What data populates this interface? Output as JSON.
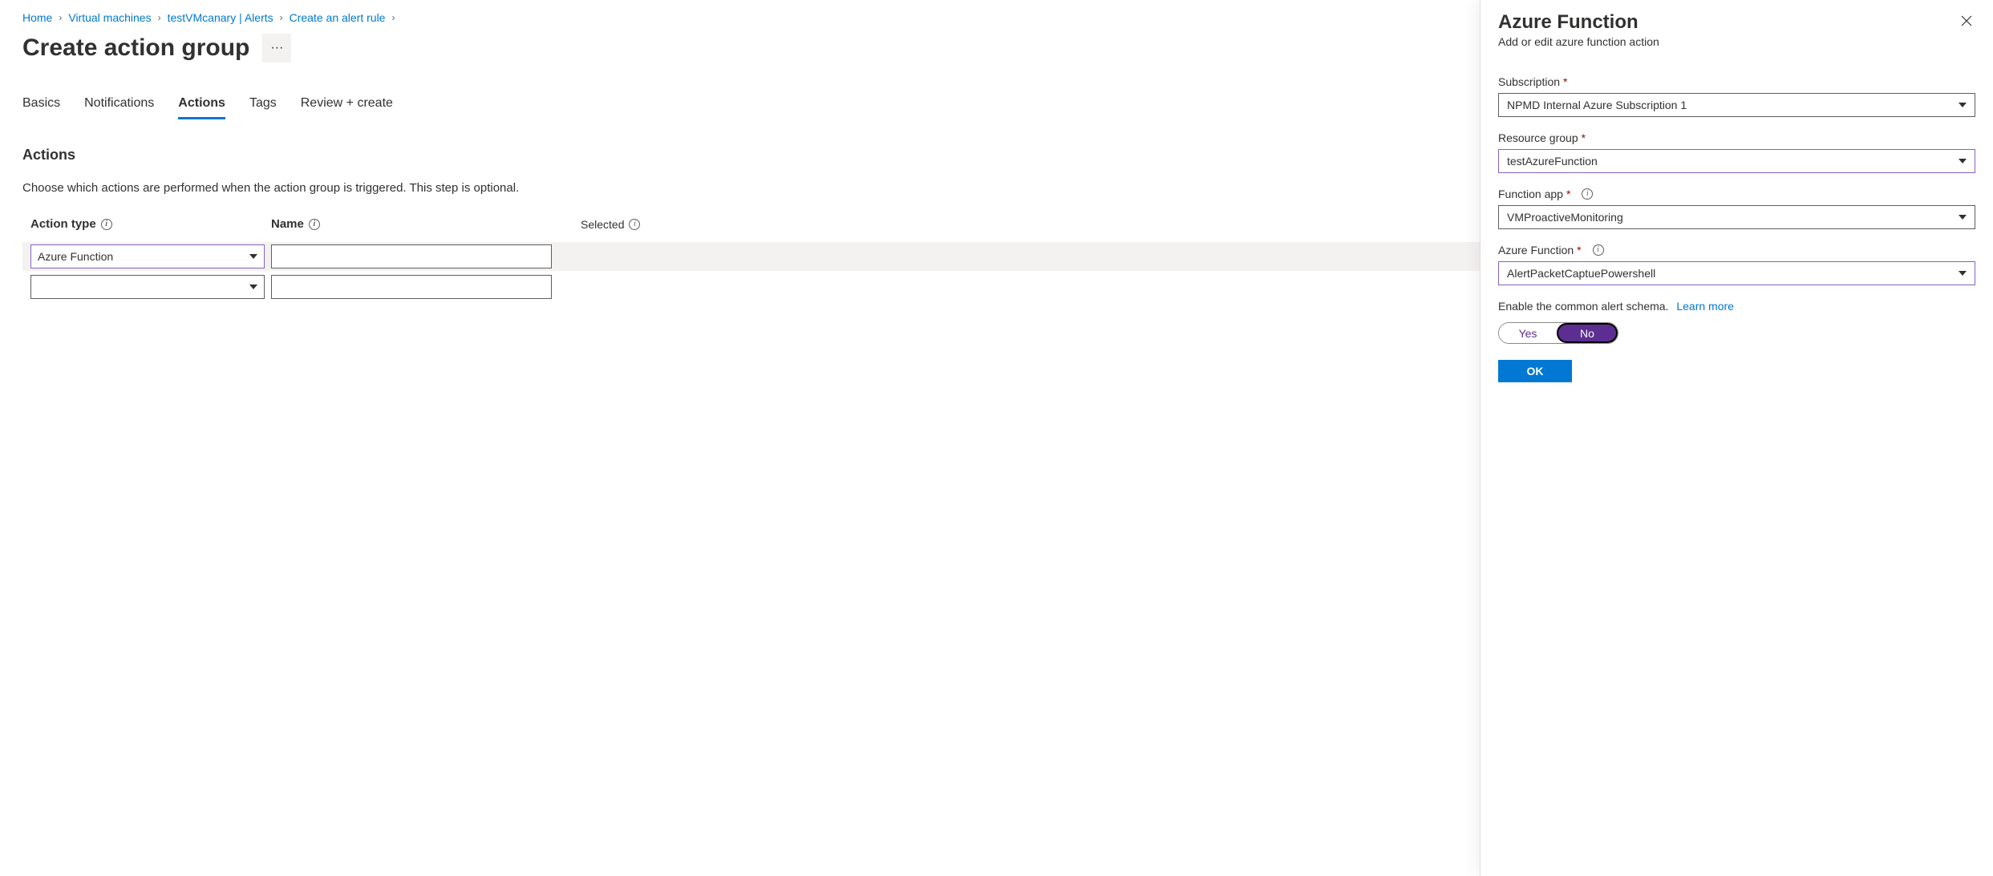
{
  "breadcrumb": {
    "home": "Home",
    "vms": "Virtual machines",
    "canary": "testVMcanary | Alerts",
    "createRule": "Create an alert rule"
  },
  "page": {
    "title": "Create action group",
    "more": "···"
  },
  "tabs": {
    "basics": "Basics",
    "notifications": "Notifications",
    "actions": "Actions",
    "tags": "Tags",
    "review": "Review + create"
  },
  "actionsSection": {
    "heading": "Actions",
    "description": "Choose which actions are performed when the action group is triggered. This step is optional.",
    "columns": {
      "actionType": "Action type",
      "name": "Name",
      "selected": "Selected"
    },
    "rows": [
      {
        "actionType": "Azure Function",
        "name": ""
      },
      {
        "actionType": "",
        "name": ""
      }
    ]
  },
  "panel": {
    "title": "Azure Function",
    "subtitle": "Add or edit azure function action",
    "fields": {
      "subscription": {
        "label": "Subscription",
        "value": "NPMD Internal Azure Subscription 1"
      },
      "resourceGroup": {
        "label": "Resource group",
        "value": "testAzureFunction"
      },
      "functionApp": {
        "label": "Function app",
        "value": "VMProactiveMonitoring"
      },
      "azureFunction": {
        "label": "Azure Function",
        "value": "AlertPacketCaptuePowershell"
      }
    },
    "schemaText": "Enable the common alert schema.",
    "learnMore": "Learn more",
    "toggle": {
      "yes": "Yes",
      "no": "No"
    },
    "ok": "OK"
  }
}
